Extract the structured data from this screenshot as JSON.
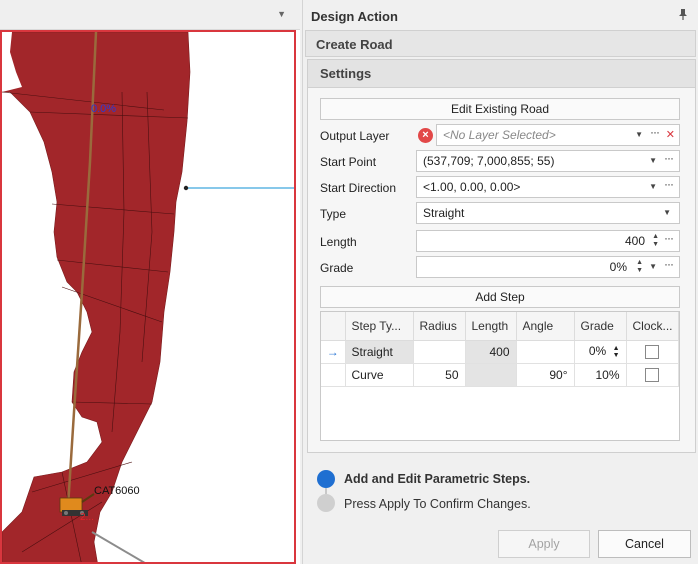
{
  "viewport": {
    "header_caret": "▼",
    "overlay_percent": "0.0%",
    "machine_label": "CAT6060"
  },
  "panel": {
    "title": "Design Action",
    "pin_icon": "pin-icon",
    "section_title": "Create Road",
    "settings_title": "Settings",
    "edit_existing_road": "Edit Existing Road",
    "output_layer": {
      "label": "Output Layer",
      "placeholder": "<No Layer Selected>"
    },
    "start_point": {
      "label": "Start Point",
      "value": "(537,709; 7,000,855; 55)"
    },
    "start_direction": {
      "label": "Start Direction",
      "value": "<1.00, 0.00, 0.00>"
    },
    "type": {
      "label": "Type",
      "value": "Straight"
    },
    "length": {
      "label": "Length",
      "value": "400"
    },
    "grade": {
      "label": "Grade",
      "value": "0%"
    },
    "add_step": "Add Step",
    "table": {
      "columns": [
        "Step Ty...",
        "Radius",
        "Length",
        "Angle",
        "Grade",
        "Clock..."
      ],
      "rows": [
        {
          "marker": "→",
          "step_type": "Straight",
          "radius": "",
          "length": "400",
          "angle": "",
          "grade": "0%",
          "clockwise": false
        },
        {
          "marker": "",
          "step_type": "Curve",
          "radius": "50",
          "length": "",
          "angle": "90°",
          "grade": "10%",
          "clockwise": false
        }
      ]
    },
    "steps": [
      {
        "text": "Add and Edit Parametric Steps.",
        "active": true
      },
      {
        "text": "Press Apply To Confirm Changes.",
        "active": false
      }
    ],
    "apply": "Apply",
    "cancel": "Cancel"
  },
  "colors": {
    "terrain": "#a2262a",
    "viewport_border": "#d9363e",
    "road_line": "#9a6a3c",
    "accent_blue": "#1f6fd1",
    "light_blue_line": "#87c8ea"
  }
}
